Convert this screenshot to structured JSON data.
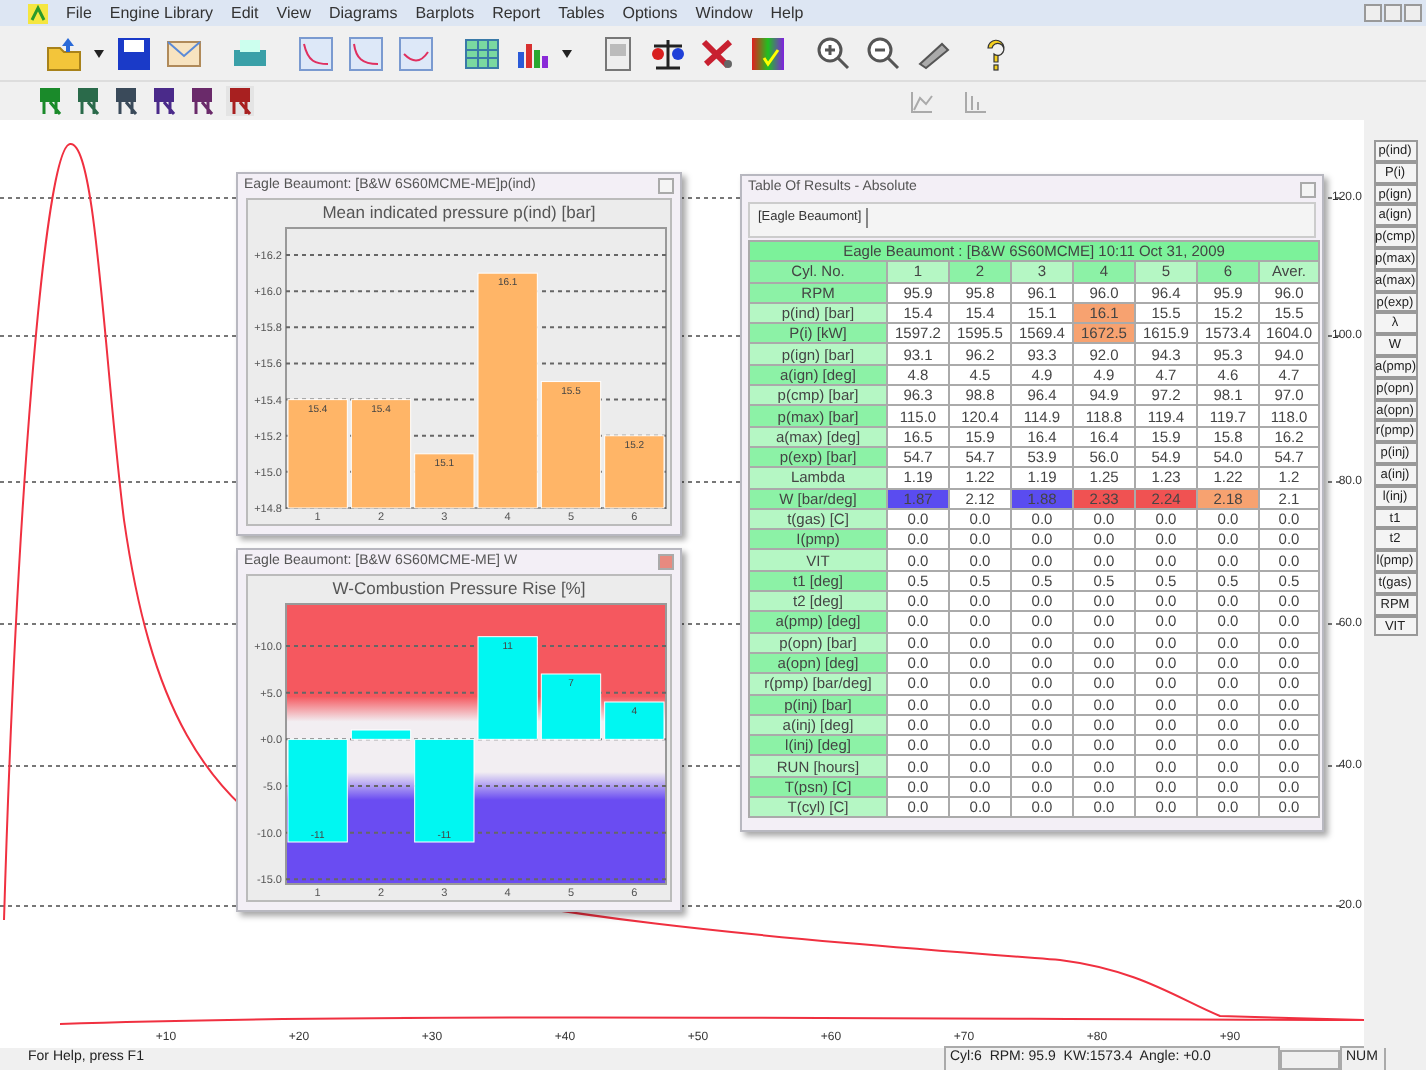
{
  "menu": [
    "File",
    "Engine Library",
    "Edit",
    "View",
    "Diagrams",
    "Barplots",
    "Report",
    "Tables",
    "Options",
    "Window",
    "Help"
  ],
  "plot": {
    "y_labels": [
      "120.0",
      "100.0",
      "80.0",
      "60.0",
      "40.0",
      "20.0"
    ],
    "x_labels": [
      "+10",
      "+20",
      "+30",
      "+40",
      "+50",
      "+60",
      "+70",
      "+80",
      "+90"
    ]
  },
  "parameter_buttons": [
    "p(ind)",
    "P(i)",
    "p(ign)",
    "a(ign)",
    "p(cmp)",
    "p(max)",
    "a(max)",
    "p(exp)",
    "λ",
    "W",
    "a(pmp)",
    "p(opn)",
    "a(opn)",
    "r(pmp)",
    "p(inj)",
    "a(inj)",
    "l(inj)",
    "t1",
    "t2",
    "l(pmp)",
    "t(gas)",
    "RPM",
    "VIT"
  ],
  "bar_windows": [
    {
      "title": "Eagle Beaumont: [B&W 6S60MCME-ME]p(ind)",
      "chart_data": {
        "type": "bar",
        "title": "Mean indicated pressure p(ind) [bar]",
        "categories": [
          "1",
          "2",
          "3",
          "4",
          "5",
          "6"
        ],
        "values": [
          15.4,
          15.4,
          15.1,
          16.1,
          15.5,
          15.2
        ],
        "ylim": [
          14.8,
          16.35
        ],
        "yticks": [
          {
            "value": 14.8,
            "label": "+14.8"
          },
          {
            "value": 15.0,
            "label": "+15.0"
          },
          {
            "value": 15.2,
            "label": "+15.2"
          },
          {
            "value": 15.4,
            "label": "+15.4"
          },
          {
            "value": 15.6,
            "label": "+15.6"
          },
          {
            "value": 15.8,
            "label": "+15.8"
          },
          {
            "value": 16.0,
            "label": "+16.0"
          },
          {
            "value": 16.2,
            "label": "+16.2"
          }
        ],
        "value_labels": [
          "15.4",
          "15.4",
          "15.1",
          "16.1",
          "15.5",
          "15.2"
        ],
        "grid": true
      }
    },
    {
      "title": "Eagle Beaumont: [B&W 6S60MCME-ME] W",
      "chart_data": {
        "type": "bar",
        "title": "W-Combustion Pressure Rise [%]",
        "categories": [
          "1",
          "2",
          "3",
          "4",
          "5",
          "6"
        ],
        "values": [
          -11,
          1,
          -11,
          11,
          7,
          4
        ],
        "ylim": [
          -15.5,
          14.5
        ],
        "yticks": [
          {
            "value": -15,
            "label": "-15.0"
          },
          {
            "value": -10,
            "label": "-10.0"
          },
          {
            "value": -5,
            "label": "-5.0"
          },
          {
            "value": 0,
            "label": "+0.0"
          },
          {
            "value": 5,
            "label": "+5.0"
          },
          {
            "value": 10,
            "label": "+10.0"
          }
        ],
        "value_labels": [
          "-11",
          null,
          "-11",
          "11",
          "7",
          "4"
        ],
        "grid": true
      }
    }
  ],
  "table_window": {
    "title": "Table Of Results - Absolute",
    "tab": "[Eagle Beaumont]",
    "heading": "Eagle Beaumont : [B&W 6S60MCME] 10:11 Oct 31, 2009",
    "columns": [
      "Cyl. No.",
      "1",
      "2",
      "3",
      "4",
      "5",
      "6",
      "Aver."
    ],
    "rows": [
      {
        "cells": [
          "RPM",
          "95.9",
          "95.8",
          "96.1",
          "96.0",
          "96.4",
          "95.9",
          "96.0"
        ]
      },
      {
        "cells": [
          "p(ind) [bar]",
          "15.4",
          "15.4",
          "15.1",
          {
            "text": "16.1",
            "color": "#f7a270"
          },
          "15.5",
          "15.2",
          "15.5"
        ]
      },
      {
        "cells": [
          "P(i) [kW]",
          "1597.2",
          "1595.5",
          "1569.4",
          {
            "text": "1672.5",
            "color": "#f7a270"
          },
          "1615.9",
          "1573.4",
          "1604.0"
        ]
      },
      {
        "cells": [
          "p(ign) [bar]",
          "93.1",
          "96.2",
          "93.3",
          "92.0",
          "94.3",
          "95.3",
          "94.0"
        ]
      },
      {
        "cells": [
          "a(ign) [deg]",
          "4.8",
          "4.5",
          "4.9",
          "4.9",
          "4.7",
          "4.6",
          "4.7"
        ]
      },
      {
        "cells": [
          "p(cmp) [bar]",
          "96.3",
          "98.8",
          "96.4",
          "94.9",
          "97.2",
          "98.1",
          "97.0"
        ]
      },
      {
        "cells": [
          "p(max) [bar]",
          "115.0",
          "120.4",
          "114.9",
          "118.8",
          "119.4",
          "119.7",
          "118.0"
        ]
      },
      {
        "cells": [
          "a(max) [deg]",
          "16.5",
          "15.9",
          "16.4",
          "16.4",
          "15.9",
          "15.8",
          "16.2"
        ]
      },
      {
        "cells": [
          "p(exp) [bar]",
          "54.7",
          "54.7",
          "53.9",
          "56.0",
          "54.9",
          "54.0",
          "54.7"
        ]
      },
      {
        "cells": [
          "Lambda",
          "1.19",
          "1.22",
          "1.19",
          "1.25",
          "1.23",
          "1.22",
          "1.2"
        ]
      },
      {
        "cells": [
          "W [bar/deg]",
          {
            "text": "1.87",
            "color": "#5a4cf0"
          },
          "2.12",
          {
            "text": "1.88",
            "color": "#5a4cf0"
          },
          {
            "text": "2.33",
            "color": "#f05252"
          },
          {
            "text": "2.24",
            "color": "#f05252"
          },
          {
            "text": "2.18",
            "color": "#f7a270"
          },
          "2.1"
        ]
      },
      {
        "cells": [
          "t(gas) [C]",
          "0.0",
          "0.0",
          "0.0",
          "0.0",
          "0.0",
          "0.0",
          "0.0"
        ]
      },
      {
        "cells": [
          "I(pmp)",
          "0.0",
          "0.0",
          "0.0",
          "0.0",
          "0.0",
          "0.0",
          "0.0"
        ]
      },
      {
        "cells": [
          "VIT",
          "0.0",
          "0.0",
          "0.0",
          "0.0",
          "0.0",
          "0.0",
          "0.0"
        ]
      },
      {
        "cells": [
          "t1 [deg]",
          "0.5",
          "0.5",
          "0.5",
          "0.5",
          "0.5",
          "0.5",
          "0.5"
        ]
      },
      {
        "cells": [
          "t2 [deg]",
          "0.0",
          "0.0",
          "0.0",
          "0.0",
          "0.0",
          "0.0",
          "0.0"
        ]
      },
      {
        "cells": [
          "a(pmp) [deg]",
          "0.0",
          "0.0",
          "0.0",
          "0.0",
          "0.0",
          "0.0",
          "0.0"
        ]
      },
      {
        "cells": [
          "p(opn) [bar]",
          "0.0",
          "0.0",
          "0.0",
          "0.0",
          "0.0",
          "0.0",
          "0.0"
        ]
      },
      {
        "cells": [
          "a(opn) [deg]",
          "0.0",
          "0.0",
          "0.0",
          "0.0",
          "0.0",
          "0.0",
          "0.0"
        ]
      },
      {
        "cells": [
          "r(pmp) [bar/deg]",
          "0.0",
          "0.0",
          "0.0",
          "0.0",
          "0.0",
          "0.0",
          "0.0"
        ]
      },
      {
        "cells": [
          "p(inj) [bar]",
          "0.0",
          "0.0",
          "0.0",
          "0.0",
          "0.0",
          "0.0",
          "0.0"
        ]
      },
      {
        "cells": [
          "a(inj) [deg]",
          "0.0",
          "0.0",
          "0.0",
          "0.0",
          "0.0",
          "0.0",
          "0.0"
        ]
      },
      {
        "cells": [
          "l(inj) [deg]",
          "0.0",
          "0.0",
          "0.0",
          "0.0",
          "0.0",
          "0.0",
          "0.0"
        ]
      },
      {
        "cells": [
          "RUN [hours]",
          "0.0",
          "0.0",
          "0.0",
          "0.0",
          "0.0",
          "0.0",
          "0.0"
        ]
      },
      {
        "cells": [
          "T(psn) [C]",
          "0.0",
          "0.0",
          "0.0",
          "0.0",
          "0.0",
          "0.0",
          "0.0"
        ]
      },
      {
        "cells": [
          "T(cyl) [C]",
          "0.0",
          "0.0",
          "0.0",
          "0.0",
          "0.0",
          "0.0",
          "0.0"
        ]
      }
    ]
  },
  "status_bar": {
    "help": "For Help, press F1",
    "readout": "Cyl:6  RPM: 95.9  KW:1573.4  Angle: +0.0",
    "indicator": "NUM"
  }
}
